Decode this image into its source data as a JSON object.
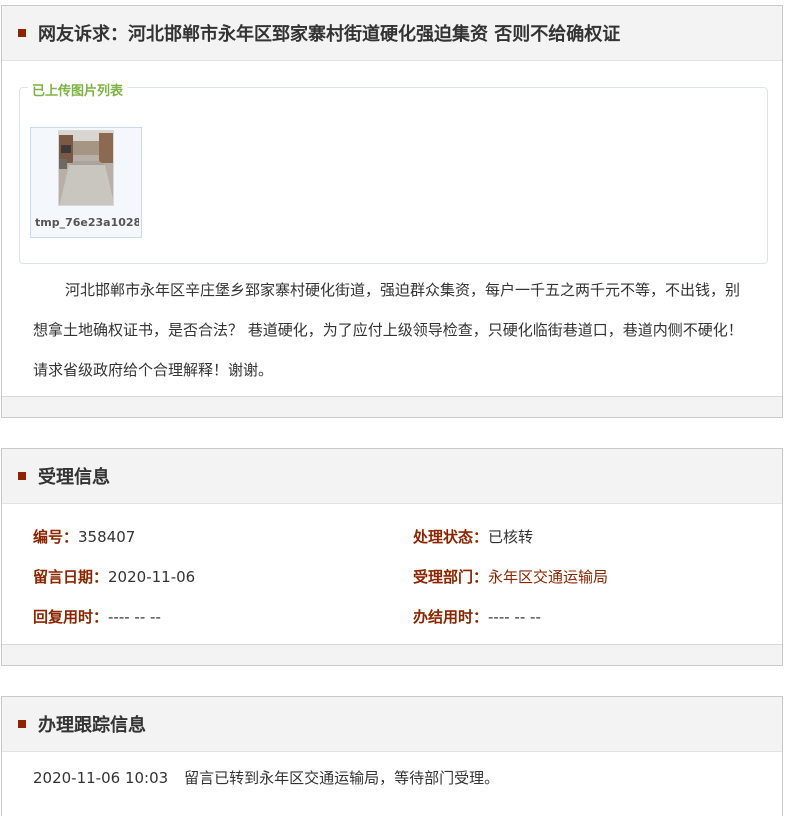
{
  "appeal": {
    "header_title": "网友诉求：河北邯郸市永年区郅家寨村街道硬化强迫集资 否则不给确权证",
    "uploaded_legend": "已上传图片列表",
    "image_filename": "tmp_76e23a1028",
    "content": "河北邯郸市永年区辛庄堡乡郅家寨村硬化街道，强迫群众集资，每户一千五之两千元不等，不出钱，别想拿土地确权证书，是否合法？ 巷道硬化，为了应付上级领导检查，只硬化临街巷道口，巷道内侧不硬化！请求省级政府给个合理解释！谢谢。"
  },
  "acceptance": {
    "header_title": "受理信息",
    "number_label": "编号：",
    "number_value": "358407",
    "status_label": "处理状态：",
    "status_value": "已核转",
    "date_label": "留言日期：",
    "date_value": "2020-11-06",
    "dept_label": "受理部门：",
    "dept_value": "永年区交通运输局",
    "reply_label": "回复用时：",
    "reply_value": "---- -- --",
    "finish_label": "办结用时：",
    "finish_value": "---- -- --"
  },
  "tracking": {
    "header_title": "办理跟踪信息",
    "entries": [
      {
        "time": "2020-11-06 10:03",
        "text": "留言已转到永年区交通运输局，等待部门受理。"
      }
    ]
  },
  "colors": {
    "accent": "#8b2500",
    "legend": "#7cb342",
    "header_bg": "#f3f3f3"
  }
}
